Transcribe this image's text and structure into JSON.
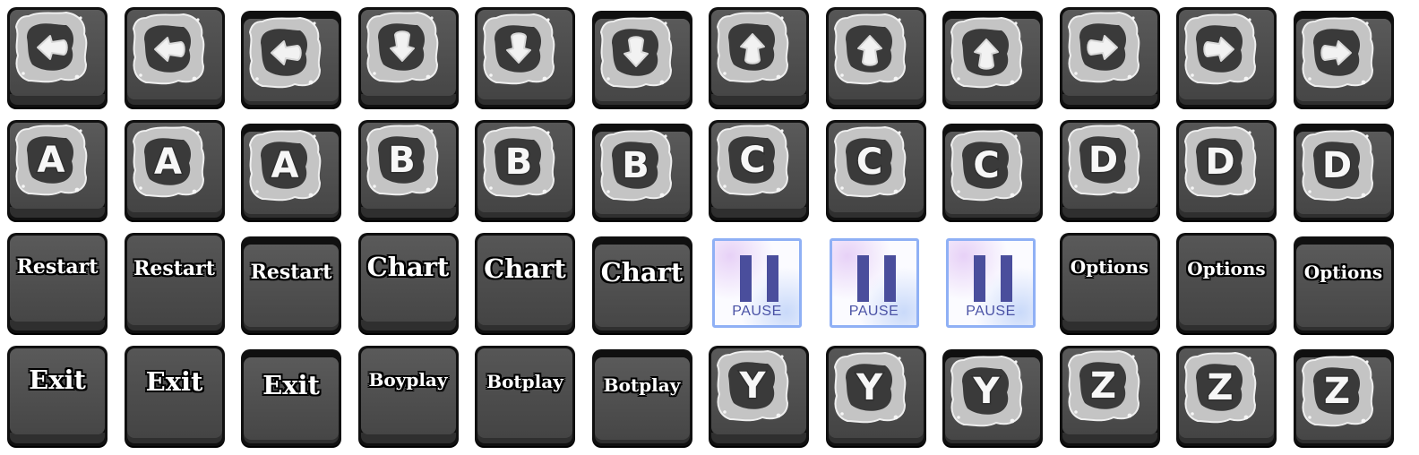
{
  "sheet": {
    "rows": [
      {
        "id": "arrows",
        "tiles": [
          {
            "kind": "splash",
            "icon": "arrow-left",
            "state": "static"
          },
          {
            "kind": "splash",
            "icon": "arrow-left",
            "state": "pressed"
          },
          {
            "kind": "splash",
            "icon": "arrow-left",
            "state": "confirm"
          },
          {
            "kind": "splash",
            "icon": "arrow-down",
            "state": "static"
          },
          {
            "kind": "splash",
            "icon": "arrow-down",
            "state": "pressed"
          },
          {
            "kind": "splash",
            "icon": "arrow-down",
            "state": "confirm"
          },
          {
            "kind": "splash",
            "icon": "arrow-up",
            "state": "static"
          },
          {
            "kind": "splash",
            "icon": "arrow-up",
            "state": "pressed"
          },
          {
            "kind": "splash",
            "icon": "arrow-up",
            "state": "confirm"
          },
          {
            "kind": "splash",
            "icon": "arrow-right",
            "state": "static"
          },
          {
            "kind": "splash",
            "icon": "arrow-right",
            "state": "pressed"
          },
          {
            "kind": "splash",
            "icon": "arrow-right",
            "state": "confirm"
          }
        ]
      },
      {
        "id": "letters",
        "tiles": [
          {
            "kind": "splash-letter",
            "text": "A",
            "state": "static"
          },
          {
            "kind": "splash-letter",
            "text": "A",
            "state": "pressed"
          },
          {
            "kind": "splash-letter",
            "text": "A",
            "state": "confirm"
          },
          {
            "kind": "splash-letter",
            "text": "B",
            "state": "static"
          },
          {
            "kind": "splash-letter",
            "text": "B",
            "state": "pressed"
          },
          {
            "kind": "splash-letter",
            "text": "B",
            "state": "confirm"
          },
          {
            "kind": "splash-letter",
            "text": "C",
            "state": "static"
          },
          {
            "kind": "splash-letter",
            "text": "C",
            "state": "pressed"
          },
          {
            "kind": "splash-letter",
            "text": "C",
            "state": "confirm"
          },
          {
            "kind": "splash-letter",
            "text": "D",
            "state": "static"
          },
          {
            "kind": "splash-letter",
            "text": "D",
            "state": "pressed"
          },
          {
            "kind": "splash-letter",
            "text": "D",
            "state": "confirm"
          }
        ]
      },
      {
        "id": "menu-buttons",
        "tiles": [
          {
            "kind": "text",
            "text": "Restart",
            "state": "static",
            "size": "sm"
          },
          {
            "kind": "text",
            "text": "Restart",
            "state": "pressed",
            "size": "sm"
          },
          {
            "kind": "text",
            "text": "Restart",
            "state": "confirm",
            "size": "sm"
          },
          {
            "kind": "text",
            "text": "Chart",
            "state": "static",
            "size": "lg"
          },
          {
            "kind": "text",
            "text": "Chart",
            "state": "pressed",
            "size": "lg"
          },
          {
            "kind": "text",
            "text": "Chart",
            "state": "confirm",
            "size": "lg"
          },
          {
            "kind": "pause",
            "text": "PAUSE"
          },
          {
            "kind": "pause",
            "text": "PAUSE"
          },
          {
            "kind": "pause",
            "text": "PAUSE"
          },
          {
            "kind": "text",
            "text": "Options",
            "state": "static",
            "size": "xs"
          },
          {
            "kind": "text",
            "text": "Options",
            "state": "pressed",
            "size": "xs"
          },
          {
            "kind": "text",
            "text": "Options",
            "state": "confirm",
            "size": "xs"
          }
        ]
      },
      {
        "id": "misc",
        "tiles": [
          {
            "kind": "text",
            "text": "Exit",
            "state": "static",
            "size": "lg"
          },
          {
            "kind": "text",
            "text": "Exit",
            "state": "pressed",
            "size": "md"
          },
          {
            "kind": "text",
            "text": "Exit",
            "state": "confirm",
            "size": "md"
          },
          {
            "kind": "text",
            "text": "Boyplay",
            "state": "static",
            "size": "xs"
          },
          {
            "kind": "text",
            "text": "Botplay",
            "state": "pressed",
            "size": "xs"
          },
          {
            "kind": "text",
            "text": "Botplay",
            "state": "confirm",
            "size": "xs"
          },
          {
            "kind": "splash-letter",
            "text": "Y",
            "state": "static"
          },
          {
            "kind": "splash-letter",
            "text": "Y",
            "state": "pressed"
          },
          {
            "kind": "splash-letter",
            "text": "Y",
            "state": "confirm"
          },
          {
            "kind": "splash-letter",
            "text": "Z",
            "state": "static"
          },
          {
            "kind": "splash-letter",
            "text": "Z",
            "state": "pressed"
          },
          {
            "kind": "splash-letter",
            "text": "Z",
            "state": "confirm"
          }
        ]
      }
    ]
  },
  "colors": {
    "key_border": "#101010",
    "key_face": "#4d4d4d",
    "splash_outer": "#c4c4c4",
    "splash_inner": "#3a3a3a",
    "glyph": "#f2f2f2",
    "pause_border": "#8fb0f5",
    "pause_bars": "#4a4e9c"
  }
}
